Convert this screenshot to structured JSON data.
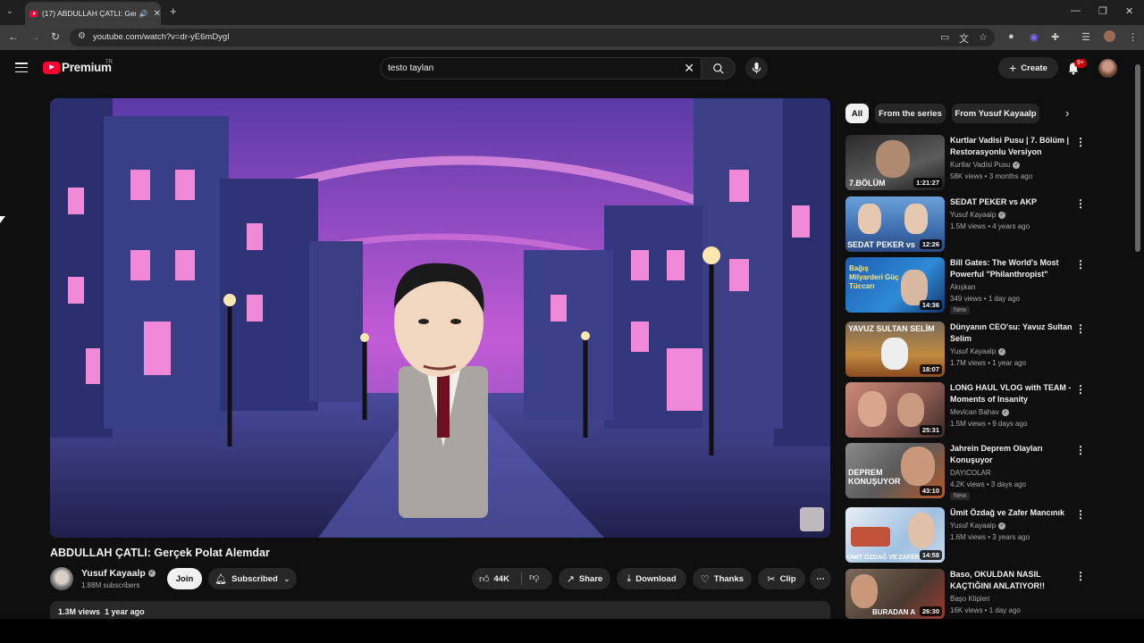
{
  "browser": {
    "tab_title": "(17) ABDULLAH ÇATLI: Gerç",
    "url": "youtube.com/watch?v=dr-yE6mDygI",
    "new_tab_label": "+"
  },
  "header": {
    "logo_text": "Premium",
    "region": "TR",
    "search_query": "testo taylan",
    "create_label": "Create",
    "notifications": "9+"
  },
  "video": {
    "title": "ABDULLAH ÇATLI: Gerçek Polat Alemdar",
    "channel": "Yusuf Kayaalp",
    "subscribers": "1.88M subscribers",
    "join_label": "Join",
    "subscribed_label": "Subscribed",
    "likes": "44K",
    "share_label": "Share",
    "download_label": "Download",
    "thanks_label": "Thanks",
    "clip_label": "Clip",
    "views": "1.3M views",
    "age": "1 year ago"
  },
  "chips": [
    "All",
    "From the series",
    "From Yusuf Kayaalp"
  ],
  "recommendations": [
    {
      "title": "Kurtlar Vadisi Pusu | 7. Bölüm | Restorasyonlu Versiyon",
      "channel": "Kurtlar Vadisi Pusu",
      "meta": "58K views • 3 months ago",
      "duration": "1:21:27",
      "thumb_text": "7.BÖLÜM",
      "new": ""
    },
    {
      "title": "SEDAT PEKER vs AKP",
      "channel": "Yusuf Kayaalp",
      "meta": "1.5M views • 4 years ago",
      "duration": "12:26",
      "thumb_text": "SEDAT PEKER vs",
      "new": ""
    },
    {
      "title": "Bill Gates: The World's Most Powerful \"Philanthropist\"",
      "channel": "Akışkan",
      "meta": "349 views • 1 day ago",
      "duration": "14:36",
      "thumb_text": "Bağış Milyarderi Güç Tüccarı",
      "new": "New"
    },
    {
      "title": "Dünyanın CEO'su: Yavuz Sultan Selim",
      "channel": "Yusuf Kayaalp",
      "meta": "1.7M views • 1 year ago",
      "duration": "18:07",
      "thumb_text": "YAVUZ SULTAN SELİM",
      "new": ""
    },
    {
      "title": "LONG HAUL VLOG with TEAM - Moments of Insanity",
      "channel": "Mevlcan Bahav",
      "meta": "1.5M views • 9 days ago",
      "duration": "25:31",
      "thumb_text": "",
      "new": ""
    },
    {
      "title": "Jahrein Deprem Olayları Konuşuyor",
      "channel": "DAYICOLAR",
      "meta": "4.2K views • 3 days ago",
      "duration": "43:10",
      "thumb_text": "DEPREM KONUŞUYOR",
      "new": "New"
    },
    {
      "title": "Ümit Özdağ ve Zafer Mancınık",
      "channel": "Yusuf Kayaalp",
      "meta": "1.6M views • 3 years ago",
      "duration": "14:58",
      "thumb_text": "ÜMİT ÖZDAĞ VE ZAFER",
      "new": ""
    },
    {
      "title": "Baso, OKULDAN NASIL KAÇTIĞINI ANLATIYOR!!",
      "channel": "Başo Klipleri",
      "meta": "16K views • 1 day ago",
      "duration": "26:30",
      "thumb_text": "BURADAN A",
      "new": ""
    }
  ],
  "colors": {
    "background": "#0f0f0f",
    "brand": "#ff0033",
    "surface": "#272727"
  }
}
